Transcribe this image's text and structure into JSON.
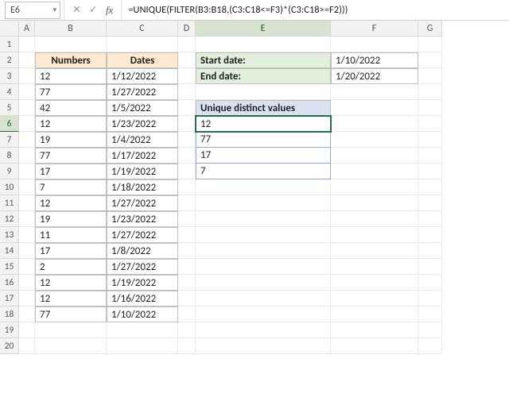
{
  "nameBox": "E6",
  "formula": "=UNIQUE(FILTER(B3:B18,(C3:C18<=F3)*(C3:C18>=F2)))",
  "cols": [
    "A",
    "B",
    "C",
    "D",
    "E",
    "F",
    "G"
  ],
  "rows": [
    "1",
    "2",
    "3",
    "4",
    "5",
    "6",
    "7",
    "8",
    "9",
    "10",
    "11",
    "12",
    "13",
    "14",
    "15",
    "16",
    "17",
    "18",
    "19",
    "20"
  ],
  "thNumbers": "Numbers",
  "thDates": "Dates",
  "tableB": [
    "12",
    "77",
    "42",
    "12",
    "19",
    "77",
    "17",
    "7",
    "12",
    "19",
    "11",
    "17",
    "2",
    "12",
    "12",
    "77"
  ],
  "tableC": [
    "1/12/2022",
    "1/27/2022",
    "1/5/2022",
    "1/23/2022",
    "1/4/2022",
    "1/17/2022",
    "1/19/2022",
    "1/18/2022",
    "1/27/2022",
    "1/23/2022",
    "1/27/2022",
    "1/8/2022",
    "1/27/2022",
    "1/19/2022",
    "1/16/2022",
    "1/10/2022"
  ],
  "lblStart": "Start date:",
  "lblEnd": "End date:",
  "valStart": "1/10/2022",
  "valEnd": "1/20/2022",
  "thUnique": "Unique distinct values",
  "unique": [
    "12",
    "77",
    "17",
    "7"
  ],
  "icons": {
    "cancel": "✕",
    "confirm": "✓",
    "fx": "fx",
    "dd": "▾"
  }
}
